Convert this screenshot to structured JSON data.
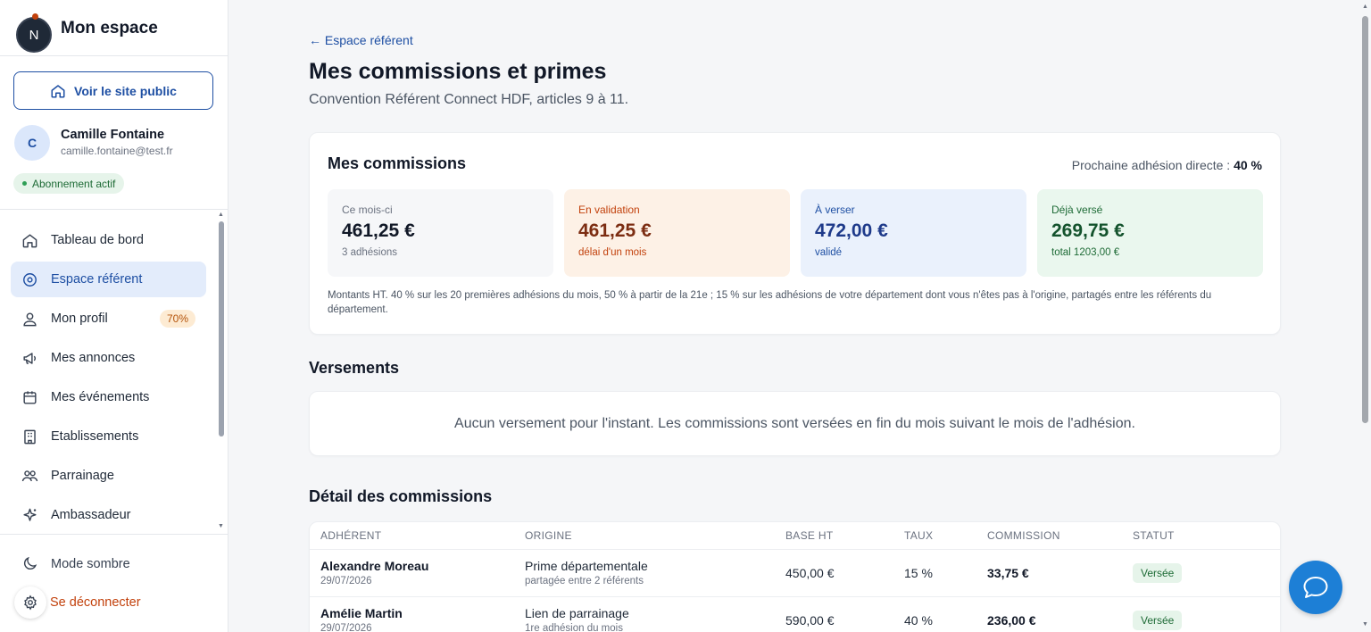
{
  "app": {
    "logo_letter": "N",
    "title": "Mon espace"
  },
  "sidebar": {
    "public_button": "Voir le site public",
    "user": {
      "initial": "C",
      "name": "Camille Fontaine",
      "email": "camille.fontaine@test.fr",
      "subscription": "Abonnement actif"
    },
    "items": [
      {
        "label": "Tableau de bord",
        "icon": "home-icon"
      },
      {
        "label": "Espace référent",
        "icon": "location-icon",
        "active": true
      },
      {
        "label": "Mon profil",
        "icon": "user-icon",
        "badge": "70%"
      },
      {
        "label": "Mes annonces",
        "icon": "megaphone-icon"
      },
      {
        "label": "Mes événements",
        "icon": "calendar-icon"
      },
      {
        "label": "Etablissements",
        "icon": "building-icon"
      },
      {
        "label": "Parrainage",
        "icon": "users-icon"
      },
      {
        "label": "Ambassadeur",
        "icon": "sparkle-icon"
      }
    ],
    "dark_mode": "Mode sombre",
    "logout": "Se déconnecter"
  },
  "main": {
    "back_link": "← Espace référent",
    "title": "Mes commissions et primes",
    "subtitle": "Convention Référent Connect HDF, articles 9 à 11.",
    "commissions": {
      "title": "Mes commissions",
      "next_rate_label": "Prochaine adhésion directe :",
      "next_rate_value": "40 %",
      "stats": [
        {
          "label": "Ce mois-ci",
          "value": "461,25 €",
          "sub": "3 adhésions"
        },
        {
          "label": "En validation",
          "value": "461,25 €",
          "sub": "délai d'un mois"
        },
        {
          "label": "À verser",
          "value": "472,00 €",
          "sub": "validé"
        },
        {
          "label": "Déjà versé",
          "value": "269,75 €",
          "sub": "total 1203,00 €"
        }
      ],
      "note": "Montants HT. 40 % sur les 20 premières adhésions du mois, 50 % à partir de la 21e ; 15 % sur les adhésions de votre département dont vous n'êtes pas à l'origine, partagés entre les référents du département."
    },
    "versements": {
      "title": "Versements",
      "empty": "Aucun versement pour l'instant. Les commissions sont versées en fin du mois suivant le mois de l'adhésion."
    },
    "detail": {
      "title": "Détail des commissions",
      "headers": [
        "ADHÉRENT",
        "ORIGINE",
        "BASE HT",
        "TAUX",
        "COMMISSION",
        "STATUT"
      ],
      "rows": [
        {
          "name": "Alexandre Moreau",
          "date": "29/07/2026",
          "origin": "Prime départementale",
          "origin_sub": "partagée entre 2 référents",
          "base": "450,00 €",
          "rate": "15 %",
          "commission": "33,75 €",
          "status": "Versée"
        },
        {
          "name": "Amélie Martin",
          "date": "29/07/2026",
          "origin": "Lien de parrainage",
          "origin_sub": "1re adhésion du mois",
          "base": "590,00 €",
          "rate": "40 %",
          "commission": "236,00 €",
          "status": "Versée"
        }
      ]
    }
  },
  "colors": {
    "accent": "#1e4fa3",
    "chat": "#1d7fd6",
    "danger": "#c2410c"
  }
}
